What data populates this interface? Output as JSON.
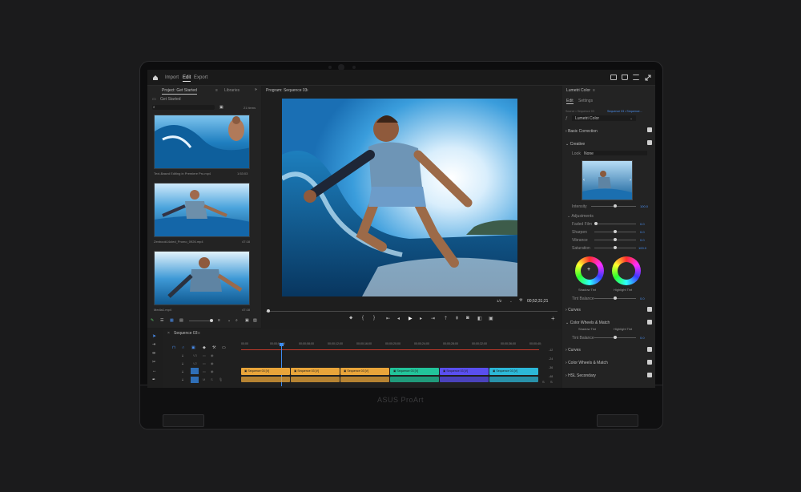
{
  "nav": {
    "import": "Import",
    "edit": "Edit",
    "export": "Export"
  },
  "project": {
    "tab_project": "Project: Get Started",
    "tab_libraries": "Libraries",
    "folder": "Get Started",
    "count": "21 items",
    "clips": [
      {
        "name": "Text-Based Editing in Premiere Pro.mp4",
        "duration": "1:53:03"
      },
      {
        "name": "Zenbook14oled_Promo_0926.mp4",
        "duration": "47:18"
      },
      {
        "name": "Media1.mp4",
        "duration": "47:18"
      }
    ]
  },
  "program": {
    "title": "Program: Sequence 03",
    "fraction": "1/2",
    "timecode": "00;52;31;21"
  },
  "lumetri": {
    "title": "Lumetri Color",
    "tab_edit": "Edit",
    "tab_settings": "Settings",
    "source": "Source • Sequence 03",
    "target": "Sequence 03 • Sequence...",
    "preset": "Lumetri Color",
    "basic_correction": "Basic Correction",
    "creative": "Creative",
    "look_label": "Look",
    "look_value": "None",
    "intensity_label": "Intensity",
    "intensity_value": "100.0",
    "adjustments": "Adjustments",
    "adj": [
      {
        "label": "Faded Film",
        "value": "0.0"
      },
      {
        "label": "Sharpen",
        "value": "0.0"
      },
      {
        "label": "Vibrance",
        "value": "0.0"
      },
      {
        "label": "Saturation",
        "value": "100.0"
      }
    ],
    "shadow_tint": "Shadow Tint",
    "highlight_tint": "Highlight Tint",
    "tint_balance": "Tint Balance",
    "tint_value": "0.0",
    "curves": "Curves",
    "cwm": "Color Wheels & Match",
    "shadow_tint2": "Shadow Tint",
    "highlight_tint2": "Highlight Tint",
    "tint_balance2": "Tint Balance",
    "tint_value2": "0.0",
    "curves2": "Curves",
    "cwm2": "Color Wheels & Match",
    "hsl": "HSL Secondary"
  },
  "timeline": {
    "title": "Sequence 03",
    "timecodes": [
      "00;00",
      "00;00;04;00",
      "00;00;08;00",
      "00;00;12;00",
      "00;00;16;00",
      "00;00;20;00",
      "00;00;24;00",
      "00;00;28;00",
      "00;00;32;00",
      "00;00;36;00",
      "00;00;40;"
    ],
    "clips": [
      {
        "label": "Sequence 03 [V]",
        "color": "#e9a53a"
      },
      {
        "label": "Sequence 03 [V]",
        "color": "#e9a53a"
      },
      {
        "label": "Sequence 03 [V]",
        "color": "#e9a53a"
      },
      {
        "label": "Sequence 03 [V]",
        "color": "#22c49a"
      },
      {
        "label": "Sequence 03 [V]",
        "color": "#5a4ff0"
      },
      {
        "label": "Sequence 03 [V]",
        "color": "#2cb8d8"
      }
    ],
    "db": [
      "-12",
      "-24",
      "-36",
      "-48"
    ]
  },
  "laptop": {
    "brand": "ASUS ProArt"
  },
  "accent": "#3d8cf0"
}
